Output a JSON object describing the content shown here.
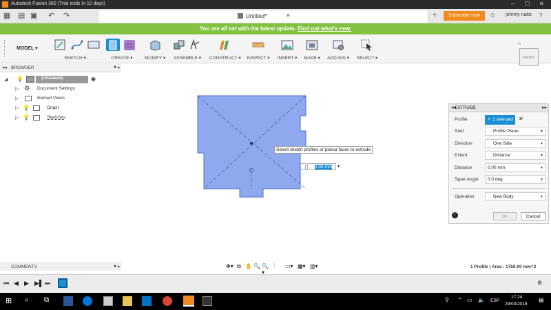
{
  "titlebar": {
    "title": "Autodesk Fusion 360 (Trial ends in 10 days)",
    "minimize": "–",
    "maximize": "☐",
    "close": "✕"
  },
  "tabbar": {
    "doc_title": "Untitled*",
    "subscribe_label": "Subscribe now",
    "user_name": "johnny naito",
    "add_tab": "+"
  },
  "banner": {
    "text": "You are all set with the latest update.",
    "link": "Find out what's new."
  },
  "toolbar": {
    "workspace": "MODEL ▾",
    "groups": [
      "SKETCH ▾",
      "CREATE ▾",
      "MODIFY ▾",
      "ASSEMBLE ▾",
      "CONSTRUCT ▾",
      "INSPECT ▾",
      "INSERT ▾",
      "MAKE ▾",
      "ADD-INS ▾",
      "SELECT ▾"
    ]
  },
  "viewcube": {
    "label": "FRONT"
  },
  "browser": {
    "title": "BROWSER",
    "root": "(Unsaved)",
    "items": [
      "Document Settings",
      "Named Views",
      "Origin",
      "Sketches"
    ]
  },
  "canvas": {
    "tooltip": "Select sketch profiles or planar faces to extrude",
    "distance_input": "0.00 mm"
  },
  "extrude": {
    "title": "EXTRUDE",
    "profile_label": "Profile",
    "profile_value": "1 selected",
    "rows": [
      {
        "label": "Start",
        "value": "Profile Plane"
      },
      {
        "label": "Direction",
        "value": "One Side"
      },
      {
        "label": "Extent",
        "value": "Distance"
      },
      {
        "label": "Distance",
        "value": "0.00 mm"
      },
      {
        "label": "Taper Angle",
        "value": "0.0 deg"
      }
    ],
    "operation_label": "Operation",
    "operation_value": "New Body",
    "ok": "OK",
    "cancel": "Cancel"
  },
  "comments": {
    "title": "COMMENTS"
  },
  "status": {
    "text": "1 Profile | Area : 1750.00 mm^2"
  },
  "taskbar": {
    "language": "ESP",
    "time": "17:24",
    "date": "29/03/2019"
  },
  "colors": {
    "banner": "#81c341",
    "subscribe": "#f08a1c",
    "profile_fill": "#8fa9ee",
    "profile_stroke": "#4a6fd0",
    "accent": "#1a8fd6"
  }
}
